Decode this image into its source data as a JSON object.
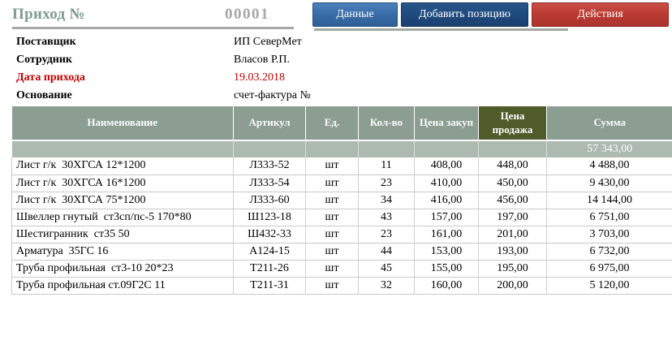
{
  "header": {
    "title": "Приход №",
    "number": "00001",
    "buttons": {
      "data_label": "Данные",
      "add_label": "Добавить позицию",
      "actions_label": "Действия"
    }
  },
  "form": {
    "supplier": {
      "label": "Поставщик",
      "value": "ИП СеверМет"
    },
    "employee": {
      "label": "Сотрудник",
      "value": "Власов Р.П."
    },
    "date": {
      "label": "Дата прихода",
      "value": "19.03.2018"
    },
    "basis": {
      "label": "Основание",
      "value": "счет-фактура №"
    }
  },
  "table": {
    "columns": [
      "Наименование",
      "Артикул",
      "Ед.",
      "Кол-во",
      "Цена закуп",
      "Цена продажа",
      "Сумма"
    ],
    "highlighted_column": "Цена продажа",
    "total_sum": "57 343,00",
    "rows": [
      [
        "Лист г/к  30ХГСА 12*1200",
        "Л333-52",
        "шт",
        "11",
        "408,00",
        "448,00",
        "4 488,00"
      ],
      [
        "Лист г/к  30ХГСА 16*1200",
        "Л333-54",
        "шт",
        "23",
        "410,00",
        "450,00",
        "9 430,00"
      ],
      [
        "Лист г/к  30ХГСА 75*1200",
        "Л333-60",
        "шт",
        "34",
        "416,00",
        "456,00",
        "14 144,00"
      ],
      [
        "Швеллер гнутый  ст3сп/пс-5 170*80",
        "Ш123-18",
        "шт",
        "43",
        "157,00",
        "197,00",
        "6 751,00"
      ],
      [
        "Шестигранник  ст35 50",
        "Ш432-33",
        "шт",
        "23",
        "161,00",
        "201,00",
        "3 703,00"
      ],
      [
        "Арматура  35ГС 16",
        "А124-15",
        "шт",
        "44",
        "153,00",
        "193,00",
        "6 732,00"
      ],
      [
        "Труба профильная  ст3-10 20*23",
        "Т211-26",
        "шт",
        "45",
        "155,00",
        "195,00",
        "6 975,00"
      ],
      [
        "Труба профильная ст.09Г2С 11",
        "Т211-31",
        "шт",
        "32",
        "160,00",
        "200,00",
        "5 120,00"
      ]
    ]
  },
  "colors": {
    "title_teal": "#7E9B93",
    "number_gray": "#A7A7A7",
    "header_green": "#8C9D92",
    "highlight_olive": "#4F5B28",
    "total_green": "#ACBAAF",
    "date_red": "#C00000",
    "button_blue": "#3A6EA8",
    "button_navy": "#1F4B7E",
    "button_red": "#B93A32"
  }
}
